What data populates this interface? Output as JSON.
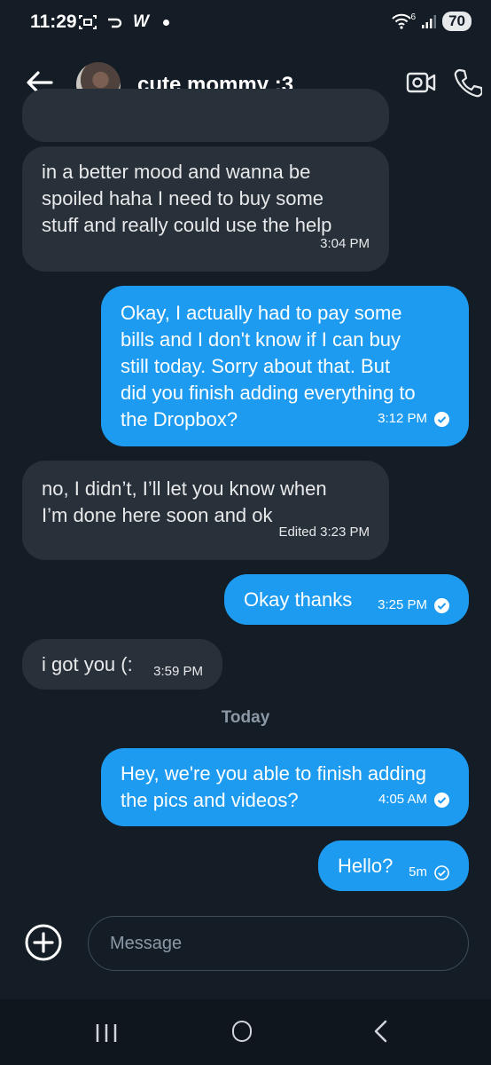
{
  "status_bar": {
    "time": "11:29",
    "app_letter": "W",
    "network": "6",
    "battery": "70"
  },
  "header": {
    "contact_name": "cute mommy :3"
  },
  "messages": [
    {
      "direction": "in",
      "text": "",
      "time": ""
    },
    {
      "direction": "in",
      "text": "in a better mood and wanna be\nspoiled haha I need to buy some\nstuff and really could use the help",
      "time": "3:04 PM"
    },
    {
      "direction": "out",
      "text": "Okay, I actually had to pay some\nbills and I don't know if I can buy\nstill today. Sorry about that. But\ndid you finish adding everything to\nthe Dropbox?",
      "time": "3:12 PM",
      "status": "read"
    },
    {
      "direction": "in",
      "text": "no, I didn’t, I’ll let you know when\nI’m done here soon and ok",
      "time": "Edited 3:23 PM"
    },
    {
      "direction": "out",
      "text": "Okay thanks",
      "time": "3:25 PM",
      "status": "read"
    },
    {
      "direction": "in",
      "text": "i got you (:",
      "time": "3:59 PM"
    },
    {
      "direction": "out",
      "text": "Hey, we're you able to finish adding\nthe pics and videos?",
      "time": "4:05 AM",
      "status": "read"
    },
    {
      "direction": "out",
      "text": "Hello?",
      "time": "5m",
      "status": "sent"
    }
  ],
  "separator": "Today",
  "composer": {
    "placeholder": "Message"
  },
  "colors": {
    "background": "#141d26",
    "incoming_bubble": "#283039",
    "outgoing_bubble": "#1d9bf0"
  }
}
